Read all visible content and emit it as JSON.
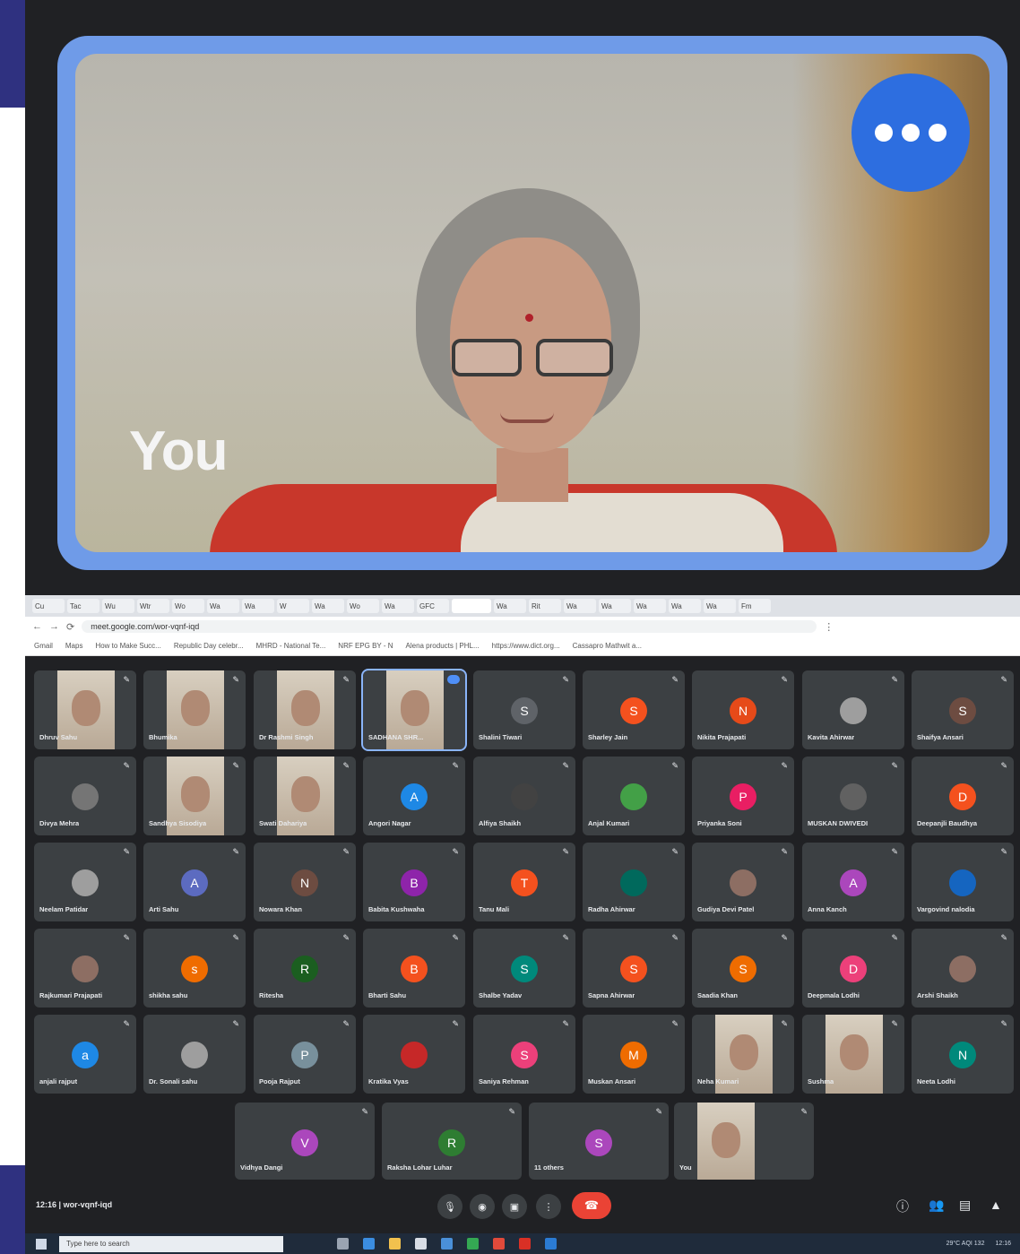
{
  "self_view": {
    "label": "You"
  },
  "browser": {
    "url": "meet.google.com/wor-vqnf-iqd",
    "tabs": [
      "Cu",
      "Tac",
      "Wu",
      "Wtr",
      "Wo",
      "Wa",
      "Wa",
      "W",
      "Wa",
      "Wo",
      "Wa",
      "GFC",
      "",
      "Wa",
      "Rit",
      "Wa",
      "Wa",
      "Wa",
      "Wa",
      "Wa",
      "Fm"
    ],
    "bookmarks": [
      "Gmail",
      "Maps",
      "How to Make Succ...",
      "Republic Day celebr...",
      "MHRD - National Te...",
      "NRF EPG BY - N",
      "Alena products | PHL...",
      "https://www.dict.org...",
      "Cassapro Mathwit a..."
    ]
  },
  "participants": [
    {
      "name": "Dhruv Sahu",
      "initial": "",
      "color": "",
      "video": true
    },
    {
      "name": "Bhumika",
      "initial": "",
      "color": "",
      "video": true
    },
    {
      "name": "Dr Rashmi Singh",
      "initial": "",
      "color": "",
      "video": true
    },
    {
      "name": "SADHANA SHR...",
      "initial": "",
      "color": "",
      "video": true,
      "selected": true
    },
    {
      "name": "Shalini Tiwari",
      "initial": "S",
      "color": "#5f6368"
    },
    {
      "name": "Sharley Jain",
      "initial": "S",
      "color": "#f4511e"
    },
    {
      "name": "Nikita Prajapati",
      "initial": "N",
      "color": "#e64a19"
    },
    {
      "name": "Kavita Ahirwar",
      "initial": "",
      "color": "#9e9e9e"
    },
    {
      "name": "Shaifya Ansari",
      "initial": "S",
      "color": "#6d4c41"
    },
    {
      "name": "Divya Mehra",
      "initial": "",
      "color": "#757575"
    },
    {
      "name": "Sandhya Sisodiya",
      "initial": "",
      "color": "",
      "video": true
    },
    {
      "name": "Swati Dahariya",
      "initial": "",
      "color": "",
      "video": true
    },
    {
      "name": "Angori Nagar",
      "initial": "A",
      "color": "#1e88e5"
    },
    {
      "name": "Alfiya Shaikh",
      "initial": "",
      "color": "#424242"
    },
    {
      "name": "Anjal Kumari",
      "initial": "",
      "color": "#43a047"
    },
    {
      "name": "Priyanka Soni",
      "initial": "P",
      "color": "#e91e63"
    },
    {
      "name": "MUSKAN DWIVEDI",
      "initial": "",
      "color": "#616161"
    },
    {
      "name": "Deepanjli Baudhya",
      "initial": "D",
      "color": "#f4511e"
    },
    {
      "name": "Neelam Patidar",
      "initial": "",
      "color": "#9e9e9e"
    },
    {
      "name": "Arti Sahu",
      "initial": "A",
      "color": "#5c6bc0"
    },
    {
      "name": "Nowara Khan",
      "initial": "N",
      "color": "#6d4c41"
    },
    {
      "name": "Babita Kushwaha",
      "initial": "B",
      "color": "#8e24aa"
    },
    {
      "name": "Tanu Mali",
      "initial": "T",
      "color": "#f4511e"
    },
    {
      "name": "Radha Ahirwar",
      "initial": "",
      "color": "#00695c"
    },
    {
      "name": "Gudiya Devi Patel",
      "initial": "",
      "color": "#8d6e63"
    },
    {
      "name": "Anna Kanch",
      "initial": "A",
      "color": "#ab47bc"
    },
    {
      "name": "Vargovind nalodia",
      "initial": "",
      "color": "#1565c0"
    },
    {
      "name": "Rajkumari Prajapati",
      "initial": "",
      "color": "#8d6e63"
    },
    {
      "name": "shikha sahu",
      "initial": "s",
      "color": "#ef6c00"
    },
    {
      "name": "Ritesha",
      "initial": "R",
      "color": "#1b5e20"
    },
    {
      "name": "Bharti Sahu",
      "initial": "B",
      "color": "#f4511e"
    },
    {
      "name": "Shalbe Yadav",
      "initial": "S",
      "color": "#00897b"
    },
    {
      "name": "Sapna Ahirwar",
      "initial": "S",
      "color": "#f4511e"
    },
    {
      "name": "Saadia Khan",
      "initial": "S",
      "color": "#ef6c00"
    },
    {
      "name": "Deepmala Lodhi",
      "initial": "D",
      "color": "#ec407a"
    },
    {
      "name": "Arshi Shaikh",
      "initial": "",
      "color": "#8d6e63"
    },
    {
      "name": "anjali rajput",
      "initial": "a",
      "color": "#1e88e5"
    },
    {
      "name": "Dr. Sonali sahu",
      "initial": "",
      "color": "#9e9e9e"
    },
    {
      "name": "Pooja Rajput",
      "initial": "P",
      "color": "#78909c"
    },
    {
      "name": "Kratika Vyas",
      "initial": "",
      "color": "#c62828"
    },
    {
      "name": "Saniya Rehman",
      "initial": "S",
      "color": "#ec407a"
    },
    {
      "name": "Muskan Ansari",
      "initial": "M",
      "color": "#ef6c00"
    },
    {
      "name": "Neha Kumari",
      "initial": "",
      "color": "",
      "video": true
    },
    {
      "name": "Sushma",
      "initial": "",
      "color": "",
      "video": true
    },
    {
      "name": "Neeta Lodhi",
      "initial": "N",
      "color": "#00897b"
    }
  ],
  "bottom_tiles": [
    {
      "name": "Vidhya Dangi",
      "initial": "V",
      "color": "#ab47bc"
    },
    {
      "name": "Raksha Lohar Luhar",
      "initial": "R",
      "color": "#2e7d32"
    },
    {
      "name": "11 others",
      "initial": "S",
      "color": "#ab47bc"
    },
    {
      "name": "You",
      "initial": "",
      "color": "",
      "video": true
    }
  ],
  "meet_bar": {
    "time": "12:16",
    "separator": "|",
    "meeting_code": "wor-vqnf-iqd"
  },
  "taskbar": {
    "search_placeholder": "Type here to search",
    "weather": "29°C  AQI 132",
    "clock": "12:16"
  }
}
